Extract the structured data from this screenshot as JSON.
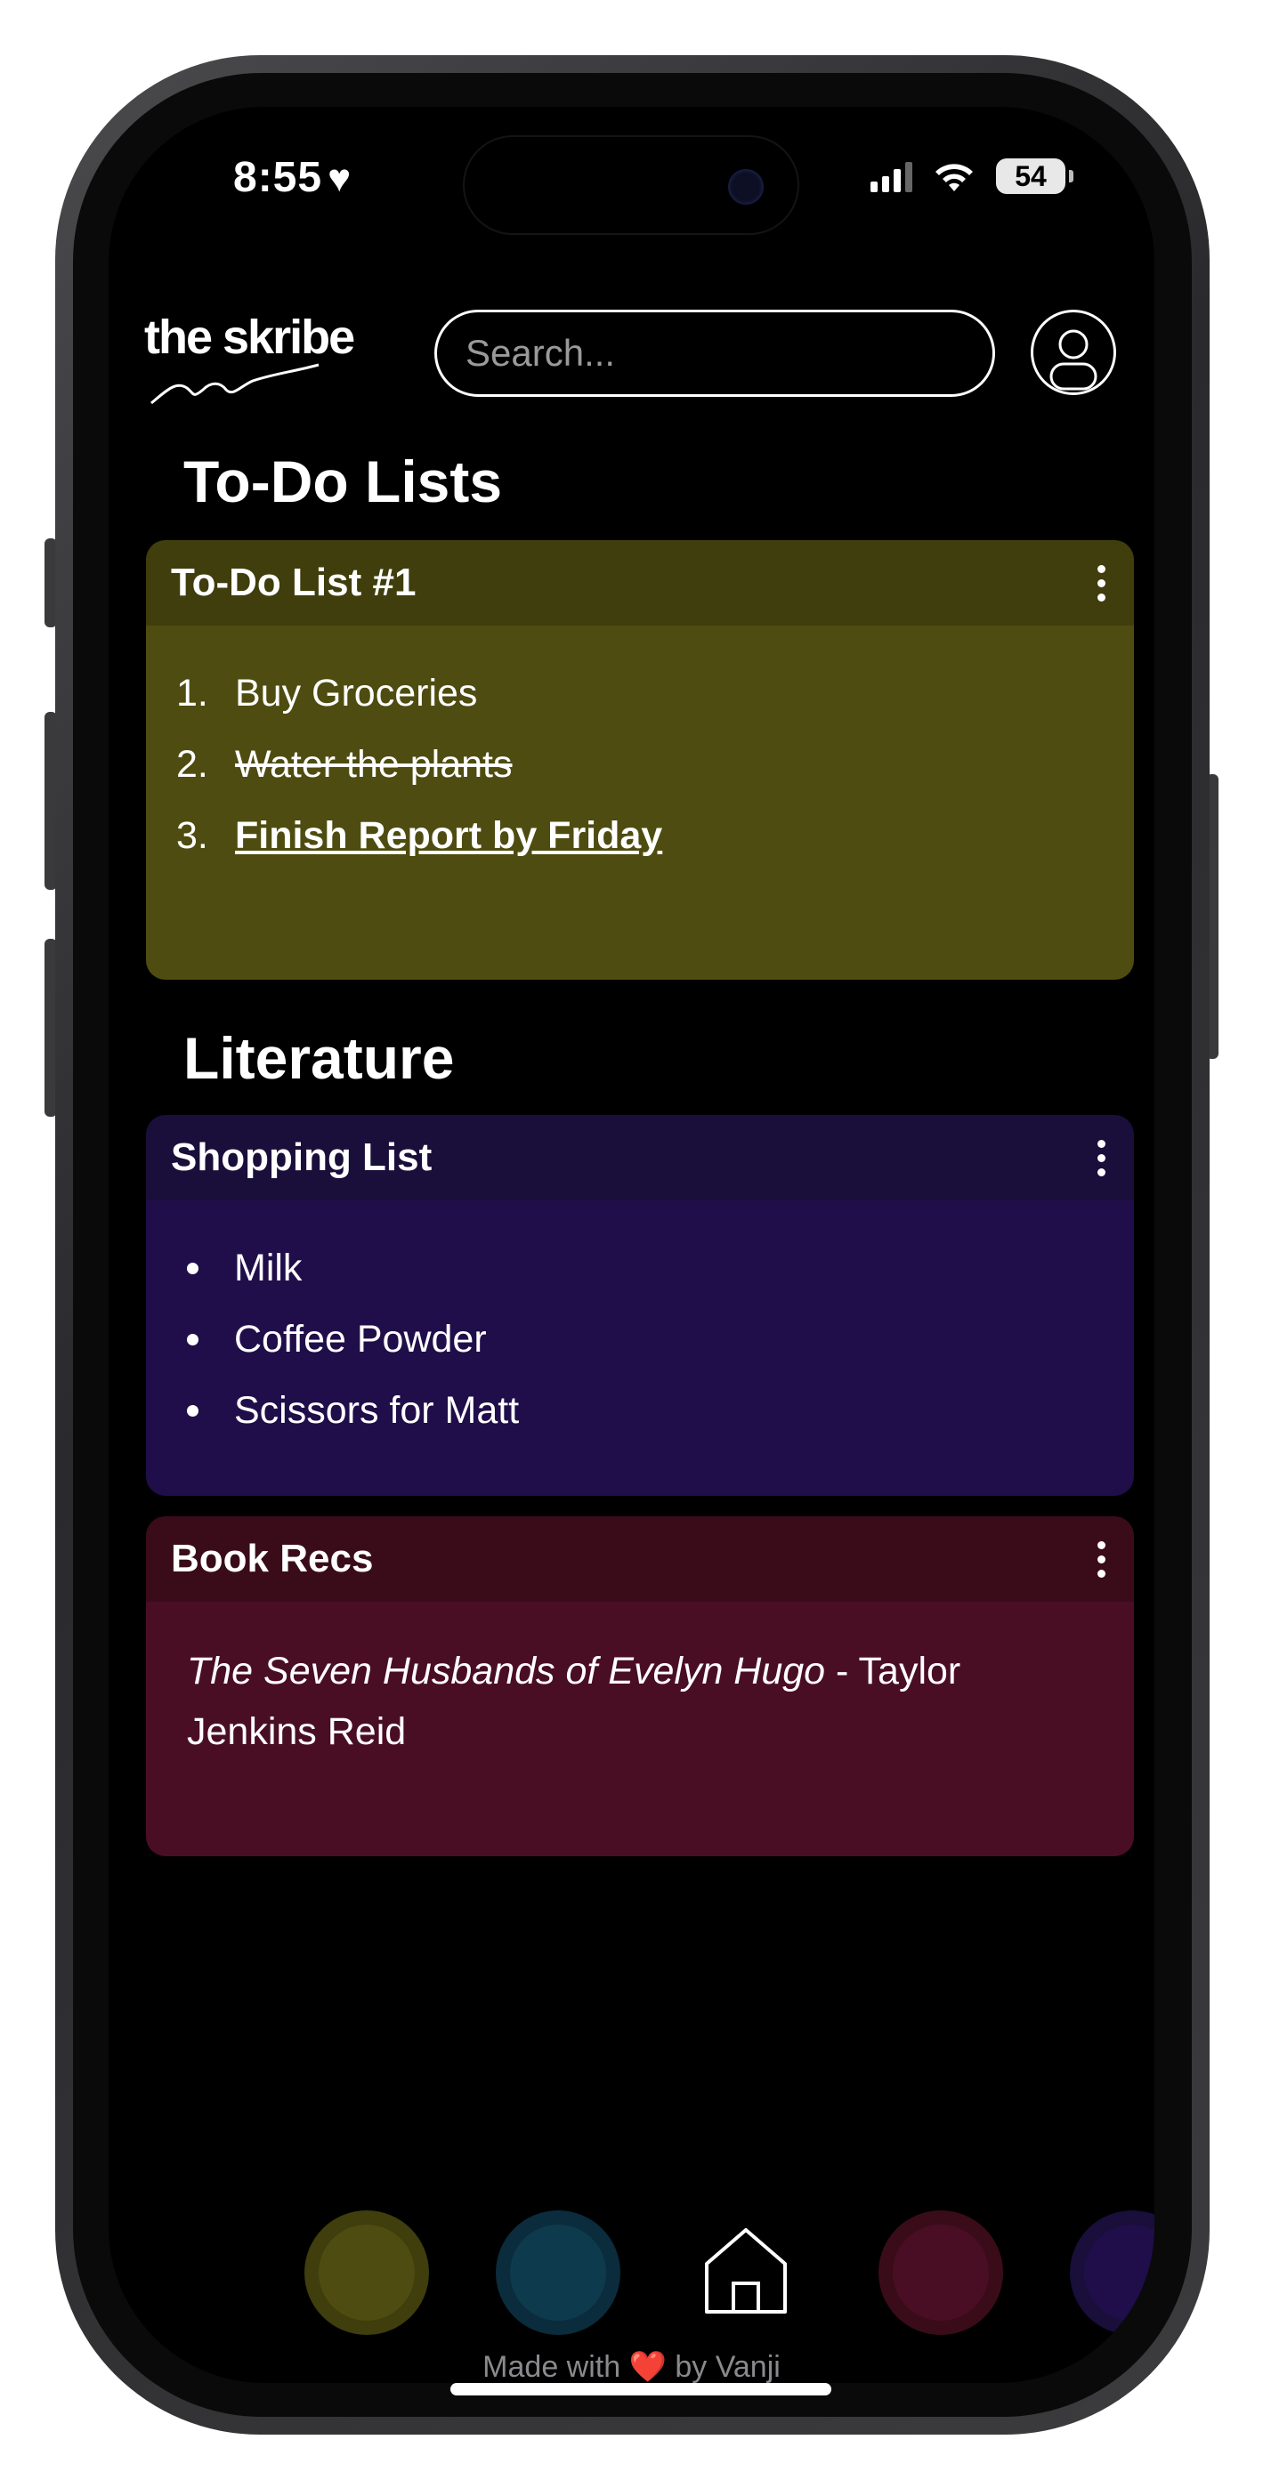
{
  "status_bar": {
    "time": "8:55",
    "heart": "♥",
    "battery": "54",
    "icons": [
      "signal-icon",
      "wifi-icon",
      "battery-icon"
    ]
  },
  "header": {
    "logo_text": "the skribe",
    "search_placeholder": "Search...",
    "icons": [
      "logo-icon",
      "profile-icon"
    ]
  },
  "sections": {
    "todo": {
      "title": "To-Do Lists",
      "card": {
        "title": "To-Do List #1",
        "items": [
          {
            "num": "1.",
            "text": "Buy Groceries",
            "style": "normal"
          },
          {
            "num": "2.",
            "text": "Water the plants",
            "style": "strikethrough"
          },
          {
            "num": "3.",
            "text": "Finish Report by Friday",
            "style": "bold-underline"
          }
        ]
      }
    },
    "literature": {
      "title": "Literature",
      "shopping": {
        "title": "Shopping List",
        "items": [
          "Milk",
          "Coffee Powder",
          "Scissors for Matt"
        ]
      },
      "book_recs": {
        "title": "Book Recs",
        "book_title": "The Seven Husbands of Evelyn Hugo",
        "book_rest": " - Taylor Jenkins Reid"
      }
    }
  },
  "bottom_nav": {
    "items": [
      "olive-filter",
      "teal-filter",
      "home-icon",
      "maroon-filter",
      "indigo-filter"
    ],
    "colors": {
      "olive": "#4e4c10",
      "teal": "#0e3a4e",
      "maroon": "#4a0e24",
      "indigo": "#200e4a"
    }
  },
  "footer": {
    "prefix": "Made with ",
    "heart": "❤️",
    "suffix": " by Vanji"
  }
}
